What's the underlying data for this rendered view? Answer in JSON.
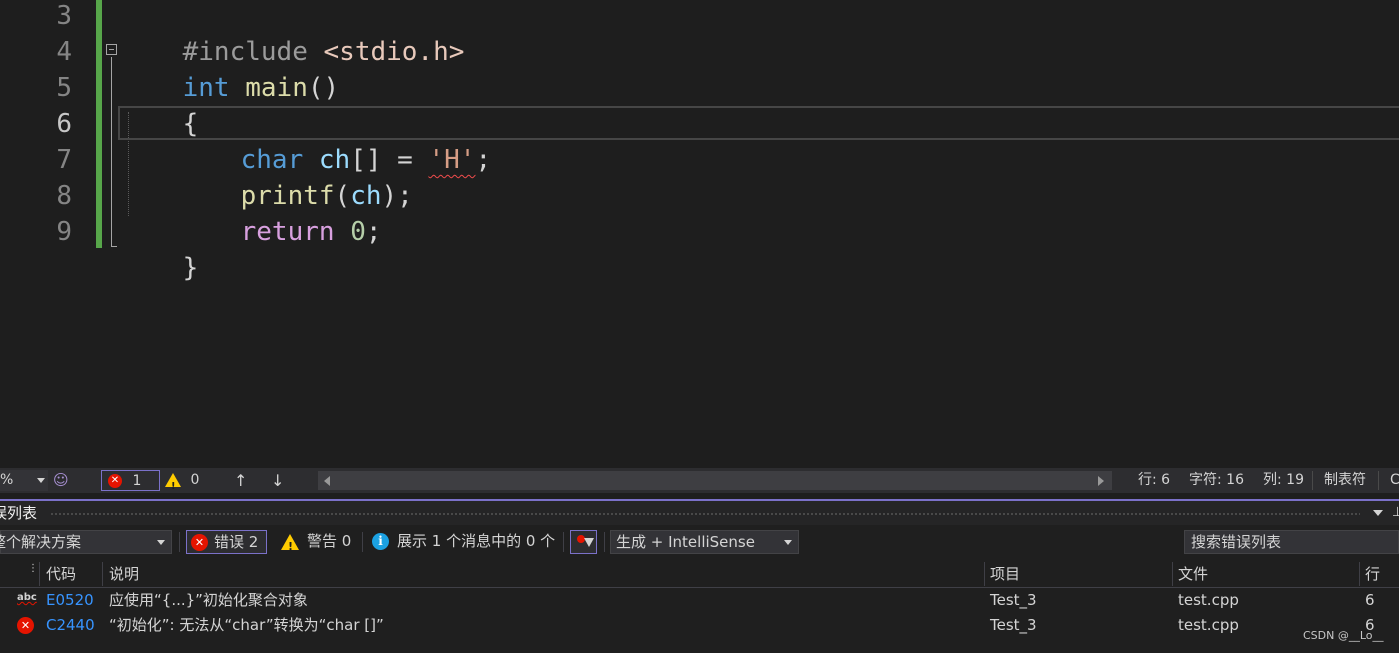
{
  "editor": {
    "line_numbers": [
      "3",
      "4",
      "5",
      "6",
      "7",
      "8",
      "9"
    ],
    "lines": {
      "l3": {
        "directive": "#include ",
        "header": "<stdio.h>"
      },
      "l4": {
        "kw": "int",
        "fn": "main",
        "rest": "()"
      },
      "l5": {
        "brace": "{"
      },
      "l6": {
        "kw": "char",
        "var": "ch",
        "op": "[] = ",
        "char_lit": "'H'",
        "end": ";"
      },
      "l7": {
        "fn": "printf",
        "open": "(",
        "var": "ch",
        "close": ");"
      },
      "l8": {
        "kw": "return",
        "num": "0",
        "end": ";"
      },
      "l9": {
        "brace": "}"
      }
    }
  },
  "editor_status": {
    "zoom_fragment": "%",
    "error_count": "1",
    "warning_count": "0",
    "row": "行: 6",
    "char": "字符: 16",
    "col": "列: 19",
    "indent": "制表符",
    "line_ending_fragment": "C"
  },
  "error_list": {
    "title": "误列表",
    "scope": "整个解决方案",
    "errors_label": "错误 2",
    "warnings_label": "警告 0",
    "messages_label": "展示 1 个消息中的 0 个",
    "build_filter": "生成 + IntelliSense",
    "search_placeholder": "搜索错误列表",
    "columns": {
      "code": "代码",
      "description": "说明",
      "project": "项目",
      "file": "文件",
      "line": "行"
    },
    "rows": [
      {
        "icon": "abc",
        "code": "E0520",
        "description": "应使用“{...}”初始化聚合对象",
        "project": "Test_3",
        "file": "test.cpp",
        "line": "6"
      },
      {
        "icon": "error",
        "code": "C2440",
        "description": "“初始化”: 无法从“char”转换为“char []”",
        "project": "Test_3",
        "file": "test.cpp",
        "line": "6"
      }
    ]
  },
  "watermark": "CSDN @__Lo__",
  "colors": {
    "accent": "#7b71c9",
    "error": "#e51400",
    "warning": "#ffcc00",
    "info": "#1ba1e2",
    "link": "#3794ff",
    "change_bar": "#57a64a"
  }
}
